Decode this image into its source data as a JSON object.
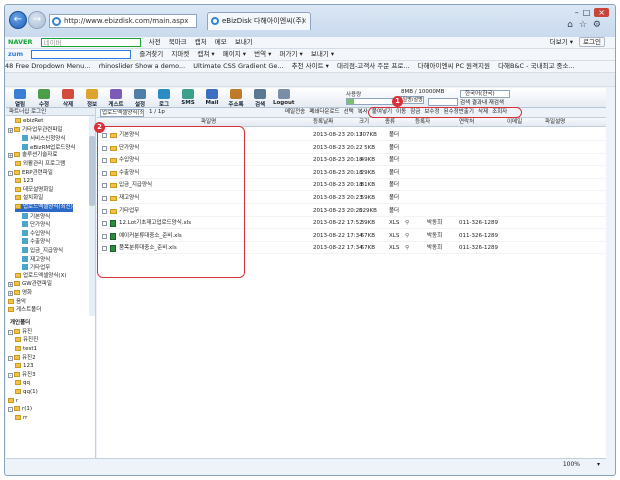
{
  "browser": {
    "url": "http://www.ebizdisk.com/main.aspx",
    "tab_title": "eBizDisk 다해아이엔씨(주)",
    "back_arrow": "←",
    "forward_arrow": "→",
    "tab_close": "×"
  },
  "toolbar_naver": {
    "brand": "NAVER",
    "search_placeholder": "네이버",
    "items": [
      "사전",
      "북마크",
      "캡처",
      "메모",
      "보내기"
    ],
    "right": [
      "더보기 ▾",
      "로그인"
    ]
  },
  "toolbar_zum": {
    "brand": "zum",
    "items": [
      "즐겨찾기",
      "지마켓",
      "캡쳐 ▾",
      "페이지 ▾",
      "번역 ▾",
      "퍼가기 ▾",
      "보내기 ▾"
    ]
  },
  "favorites": [
    "48 Free Dropdown Menu...",
    "rhinoslider Show a demo...",
    "Ultimate CSS Gradient Ge...",
    "추천 사이트 ▾",
    "대리점-고객사 주문 프로...",
    "다해아이엔씨 PC 원격지원",
    "다해B&C - 국내최고 중소..."
  ],
  "app_toolbar": {
    "buttons": [
      "열림",
      "수정",
      "삭제",
      "정보",
      "게스트",
      "설정",
      "로그",
      "SMS",
      "Mail",
      "주소록",
      "검색"
    ],
    "logout": "Logout",
    "quota_label": "사용량",
    "quota_percent": 15,
    "quota_text": "8MB / 10000MB",
    "view_select": "파일명/설명",
    "language": "한국어(한국)",
    "search_button": "검색",
    "search_option": "결과내 재검색"
  },
  "tree": {
    "header": "파트너십 로그인",
    "nodes": [
      {
        "label": "ebizRet",
        "indent": 1,
        "icon": "folder"
      },
      {
        "label": "기타업무관련파일",
        "indent": 0,
        "icon": "folder",
        "toggle": "+"
      },
      {
        "label": "서비스신청양식",
        "indent": 2,
        "icon": "doc"
      },
      {
        "label": "eBizRM업로드양식",
        "indent": 2,
        "icon": "doc"
      },
      {
        "label": "솔루션기술자료",
        "indent": 0,
        "icon": "folder",
        "toggle": "+"
      },
      {
        "label": "외활관리 프로그램",
        "indent": 1,
        "icon": "folder"
      },
      {
        "label": "ERP관련파일",
        "indent": 0,
        "icon": "folder",
        "toggle": "-"
      },
      {
        "label": "123",
        "indent": 1,
        "icon": "folder"
      },
      {
        "label": "데모설명화일",
        "indent": 1,
        "icon": "folder"
      },
      {
        "label": "설치화일",
        "indent": 1,
        "icon": "folder"
      },
      {
        "label": "업로드엑셀양식(최신)",
        "indent": 1,
        "icon": "folder",
        "selected": true
      },
      {
        "label": "기본양식",
        "indent": 2,
        "icon": "doc"
      },
      {
        "label": "단가양식",
        "indent": 2,
        "icon": "doc"
      },
      {
        "label": "수입양식",
        "indent": 2,
        "icon": "doc"
      },
      {
        "label": "수출양식",
        "indent": 2,
        "icon": "doc"
      },
      {
        "label": "입금_지급양식",
        "indent": 2,
        "icon": "doc"
      },
      {
        "label": "재고양식",
        "indent": 2,
        "icon": "doc"
      },
      {
        "label": "기타업무",
        "indent": 2,
        "icon": "doc"
      },
      {
        "label": "업로드엑셀양식(X)",
        "indent": 1,
        "icon": "folder"
      },
      {
        "label": "GW관련파일",
        "indent": 0,
        "icon": "folder",
        "toggle": "+"
      },
      {
        "label": "영화",
        "indent": 0,
        "icon": "folder",
        "toggle": "+"
      },
      {
        "label": "음악",
        "indent": 0,
        "icon": "folder"
      },
      {
        "label": "게스트폴더",
        "indent": 0,
        "icon": "folder"
      }
    ],
    "personal_header": "개인폴더",
    "personal_nodes": [
      {
        "label": "유진",
        "indent": 0,
        "toggle": "-"
      },
      {
        "label": "유진진",
        "indent": 1
      },
      {
        "label": "test1",
        "indent": 1
      },
      {
        "label": "유진2",
        "indent": 0,
        "toggle": "-"
      },
      {
        "label": "123",
        "indent": 1
      },
      {
        "label": "유진3",
        "indent": 0,
        "toggle": "-"
      },
      {
        "label": "qq",
        "indent": 1
      },
      {
        "label": "qq(1)",
        "indent": 1
      },
      {
        "label": "r",
        "indent": 0
      },
      {
        "label": "r(1)",
        "indent": 0,
        "toggle": "-"
      },
      {
        "label": "rr",
        "indent": 1
      }
    ]
  },
  "file_list": {
    "path": "업로드엑셀양식(최신)",
    "page_info": "1 / 1p",
    "actions": [
      "메일전송",
      "폐쇄다운로드",
      "선택",
      "복사",
      "붙여넣기",
      "이동",
      "잠금",
      "보수정",
      "된수정반출기",
      "삭제",
      "조회자"
    ],
    "columns": [
      "파일명",
      "등록날짜",
      "크기",
      "종류",
      "등록자",
      "연락처",
      "이메일",
      "파일설명"
    ],
    "rows": [
      {
        "name": "기본양식",
        "date": "2013-08-23 20:17",
        "size": "307KB",
        "type": "폴더",
        "owner": "",
        "phone": "",
        "kind": "folder"
      },
      {
        "name": "단가양식",
        "date": "2013-08-23 20:22",
        "size": "5KB",
        "type": "폴더",
        "owner": "",
        "phone": "",
        "kind": "folder"
      },
      {
        "name": "수입양식",
        "date": "2013-08-23 20:18",
        "size": "49KB",
        "type": "폴더",
        "owner": "",
        "phone": "",
        "kind": "folder"
      },
      {
        "name": "수출양식",
        "date": "2013-08-23 20:18",
        "size": "29KB",
        "type": "폴더",
        "owner": "",
        "phone": "",
        "kind": "folder"
      },
      {
        "name": "입금_지급양식",
        "date": "2013-08-23 20:18",
        "size": "81KB",
        "type": "폴더",
        "owner": "",
        "phone": "",
        "kind": "folder"
      },
      {
        "name": "재고양식",
        "date": "2013-08-23 20:23",
        "size": "59KB",
        "type": "폴더",
        "owner": "",
        "phone": "",
        "kind": "folder"
      },
      {
        "name": "기타업무",
        "date": "2013-08-23 20:20",
        "size": "529KB",
        "type": "폴더",
        "owner": "",
        "phone": "",
        "kind": "folder"
      },
      {
        "name": "12.Lot기초재고업로드양식.xls",
        "date": "2013-08-22 17:52",
        "size": "39KB",
        "type": "XLS",
        "owner": "박동희",
        "phone": "011-326-1289",
        "kind": "xls"
      },
      {
        "name": "예이커분류대중소_준비.xls",
        "date": "2013-08-22 17:34",
        "size": "67KB",
        "type": "XLS",
        "owner": "박동희",
        "phone": "011-326-1289",
        "kind": "xls"
      },
      {
        "name": "품목분류대중소_준비.xls",
        "date": "2013-08-22 17:34",
        "size": "67KB",
        "type": "XLS",
        "owner": "박동희",
        "phone": "011-326-1289",
        "kind": "xls"
      }
    ]
  },
  "callouts": [
    "1",
    "2"
  ],
  "status": {
    "zoom": "100%"
  }
}
